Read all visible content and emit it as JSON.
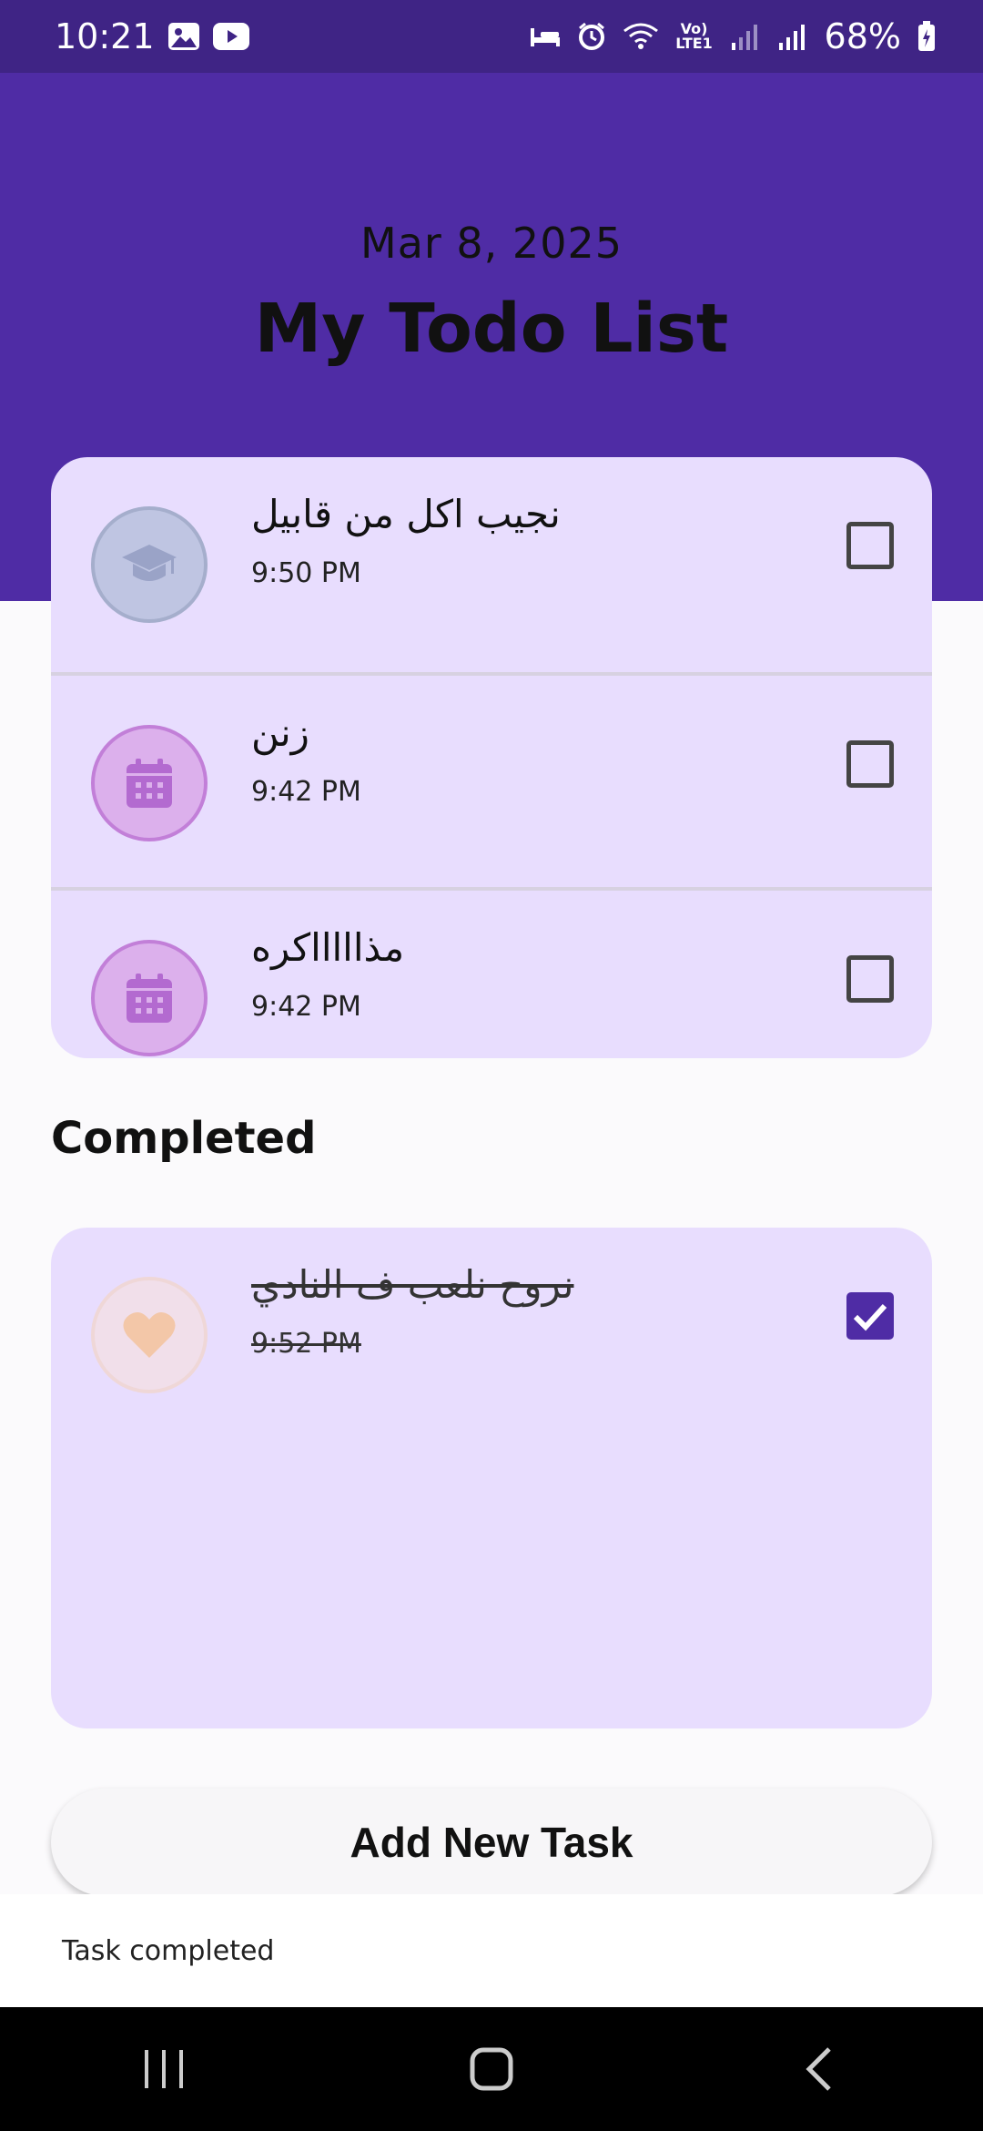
{
  "status_bar": {
    "time": "10:21",
    "battery": "68%",
    "icons": [
      "gallery-icon",
      "youtube-icon",
      "bed-icon",
      "alarm-icon",
      "wifi-icon",
      "volte-icon",
      "signal-icon",
      "battery-icon"
    ],
    "volte_label": "Vo) LTE1"
  },
  "header": {
    "date": "Mar 8, 2025",
    "title": "My Todo List",
    "background": "#4f2ca5"
  },
  "tasks": [
    {
      "title": "نجيب اكل من قابيل",
      "time": "9:50 PM",
      "icon": "graduation-cap-icon",
      "checked": false
    },
    {
      "title": "زنن",
      "time": "9:42 PM",
      "icon": "calendar-icon",
      "checked": false
    },
    {
      "title": "مذاااااكره",
      "time": "9:42 PM",
      "icon": "calendar-icon",
      "checked": false
    }
  ],
  "completed": {
    "heading": "Completed",
    "tasks": [
      {
        "title": "نروح نلعب ف النادي",
        "time": "9:52 PM",
        "icon": "heart-icon",
        "checked": true
      }
    ]
  },
  "add_button": {
    "label": "Add New Task"
  },
  "snackbar": {
    "message": "Task completed"
  },
  "colors": {
    "accent": "#4f2ca5",
    "card": "#e8ddfe",
    "status_bar": "#3f2485"
  }
}
